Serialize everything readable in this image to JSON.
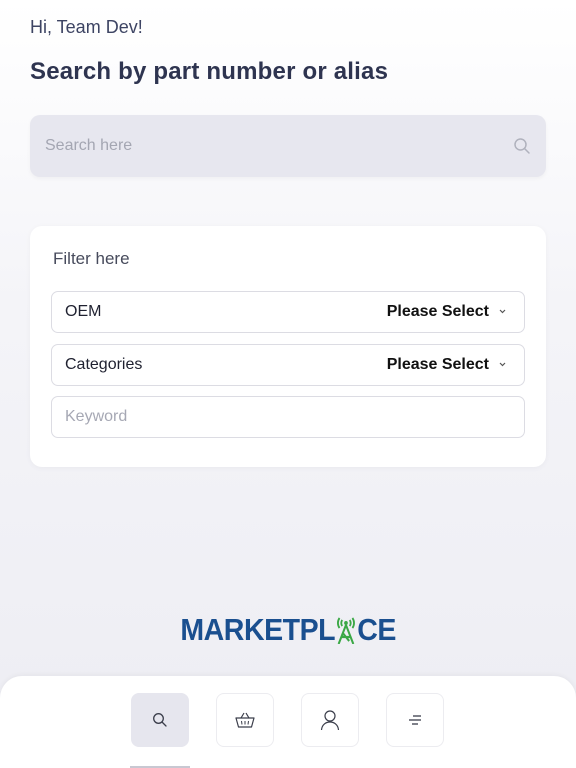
{
  "greeting": "Hi, Team Dev!",
  "headline": "Search by part number or alias",
  "search": {
    "placeholder": "Search here",
    "icon": "search-icon"
  },
  "filter": {
    "title": "Filter here",
    "oem": {
      "label": "OEM",
      "value": "Please Select"
    },
    "categories": {
      "label": "Categories",
      "value": "Please Select"
    },
    "keyword": {
      "placeholder": "Keyword"
    }
  },
  "logo": {
    "text_left": "MARKETPL",
    "text_right": "CE"
  },
  "colors": {
    "brand_blue": "#1a4f8f",
    "brand_green": "#3aa845",
    "accent_bg": "#e7e7ef"
  },
  "bottom_nav": [
    {
      "icon": "search-icon",
      "active": true
    },
    {
      "icon": "basket-icon",
      "active": false
    },
    {
      "icon": "user-icon",
      "active": false
    },
    {
      "icon": "menu-icon",
      "active": false
    }
  ]
}
